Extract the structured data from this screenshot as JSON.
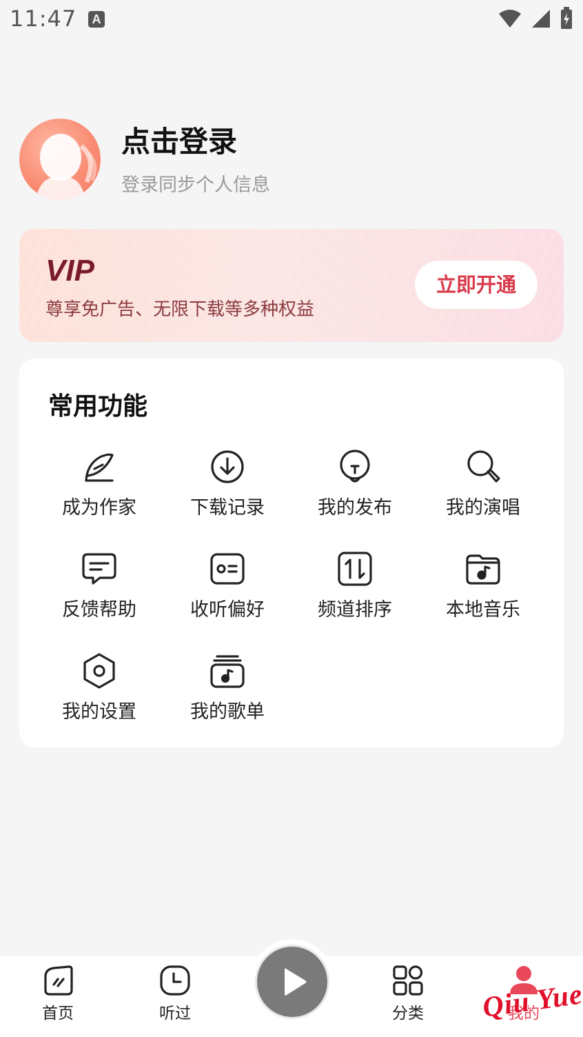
{
  "status_bar": {
    "time": "11:47",
    "icons": [
      "keyboard-a-icon",
      "wifi-icon",
      "signal-icon",
      "battery-charging-icon"
    ]
  },
  "profile": {
    "title": "点击登录",
    "subtitle": "登录同步个人信息"
  },
  "vip": {
    "title": "VIP",
    "description": "尊享免广告、无限下载等多种权益",
    "button": "立即开通"
  },
  "functions": {
    "title": "常用功能",
    "items": [
      {
        "label": "成为作家",
        "icon": "feather-pen-icon"
      },
      {
        "label": "下载记录",
        "icon": "download-circle-icon"
      },
      {
        "label": "我的发布",
        "icon": "lightbulb-icon"
      },
      {
        "label": "我的演唱",
        "icon": "microphone-search-icon"
      },
      {
        "label": "反馈帮助",
        "icon": "feedback-message-icon"
      },
      {
        "label": "收听偏好",
        "icon": "preference-card-icon"
      },
      {
        "label": "频道排序",
        "icon": "sort-arrows-icon"
      },
      {
        "label": "本地音乐",
        "icon": "music-folder-icon"
      },
      {
        "label": "我的设置",
        "icon": "settings-hexagon-icon"
      },
      {
        "label": "我的歌单",
        "icon": "playlist-icon"
      }
    ]
  },
  "bottom_nav": {
    "items": [
      {
        "label": "首页",
        "icon": "home-icon"
      },
      {
        "label": "听过",
        "icon": "history-clock-icon"
      },
      {
        "label": "分类",
        "icon": "category-grid-icon"
      },
      {
        "label": "我的",
        "icon": "profile-icon",
        "active": true
      }
    ],
    "play_icon": "play-icon"
  },
  "watermark": "Qiu Yue",
  "colors": {
    "accent": "#e9475a",
    "vip_text": "#7a1b2a",
    "vip_button_text": "#d83a4a",
    "play_button": "#7a7a7a"
  }
}
